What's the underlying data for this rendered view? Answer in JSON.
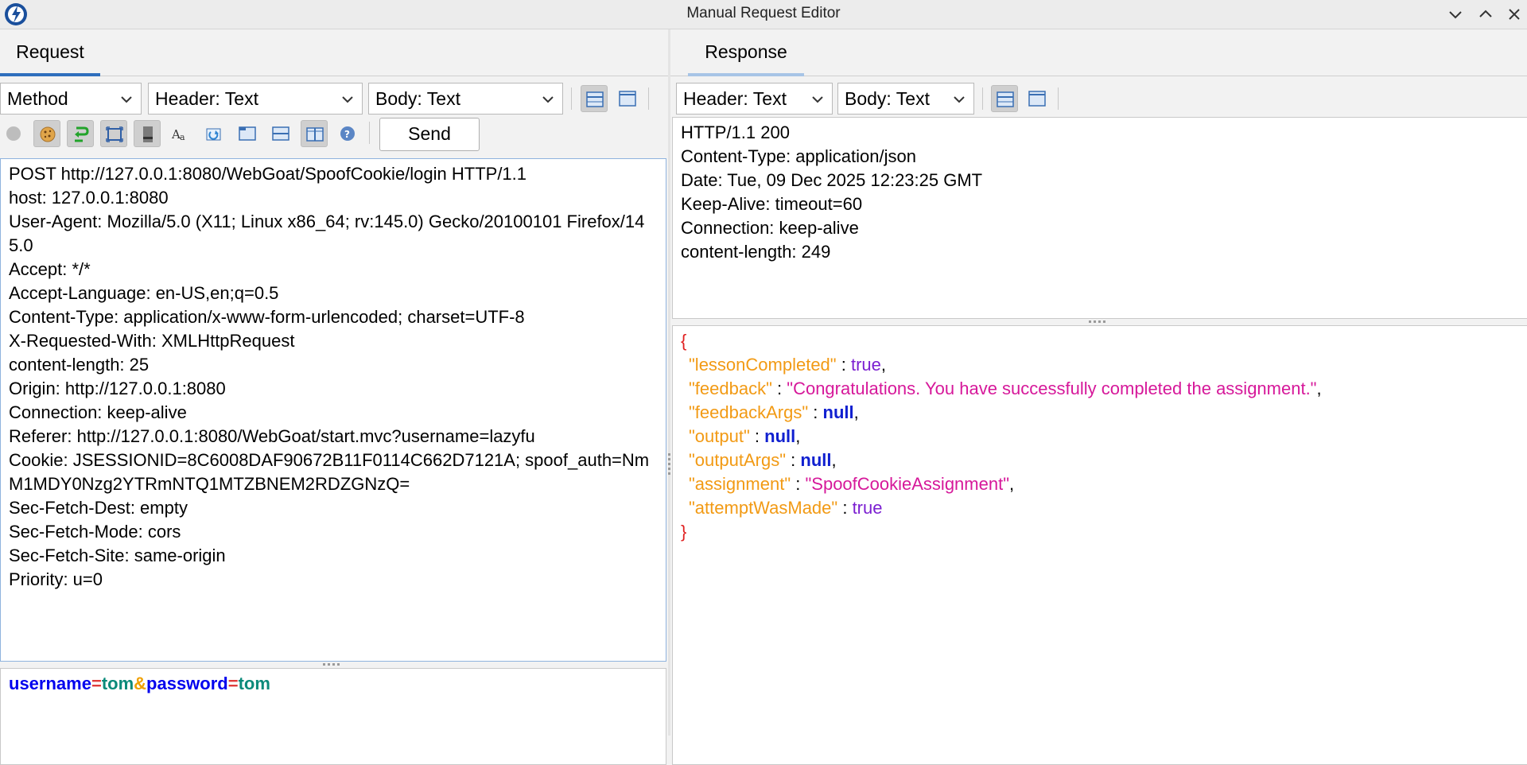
{
  "window": {
    "title": "Manual Request Editor"
  },
  "request": {
    "tab_label": "Request",
    "method_combo": "Method",
    "header_combo": "Header: Text",
    "body_combo": "Body: Text",
    "send_label": "Send",
    "header_lines": [
      "POST http://127.0.0.1:8080/WebGoat/SpoofCookie/login HTTP/1.1",
      "host: 127.0.0.1:8080",
      "User-Agent: Mozilla/5.0 (X11; Linux x86_64; rv:145.0) Gecko/20100101 Firefox/145.0",
      "Accept: */*",
      "Accept-Language: en-US,en;q=0.5",
      "Content-Type: application/x-www-form-urlencoded; charset=UTF-8",
      "X-Requested-With: XMLHttpRequest",
      "content-length: 25",
      "Origin: http://127.0.0.1:8080",
      "Connection: keep-alive",
      "Referer: http://127.0.0.1:8080/WebGoat/start.mvc?username=lazyfu",
      "Cookie: JSESSIONID=8C6008DAF90672B11F0114C662D7121A; spoof_auth=NmM1MDY0Nzg2YTRmNTQ1MTZBNEM2RDZGNzQ=",
      "Sec-Fetch-Dest: empty",
      "Sec-Fetch-Mode: cors",
      "Sec-Fetch-Site: same-origin",
      "Priority: u=0"
    ],
    "body": {
      "k1": "username",
      "eq1": "=",
      "v1": "tom",
      "amp": "&",
      "k2": "password",
      "eq2": "=",
      "v2": "tom"
    }
  },
  "response": {
    "tab_label": "Response",
    "header_combo": "Header: Text",
    "body_combo": "Body: Text",
    "header_lines": [
      "HTTP/1.1 200",
      "Content-Type: application/json",
      "Date: Tue, 09 Dec 2025 12:23:25 GMT",
      "Keep-Alive: timeout=60",
      "Connection: keep-alive",
      "content-length: 249"
    ],
    "json": {
      "open": "{",
      "close": "}",
      "entries": [
        {
          "key": "\"lessonCompleted\"",
          "value": "true",
          "type": "bool"
        },
        {
          "key": "\"feedback\"",
          "value": "\"Congratulations. You have successfully completed the assignment.\"",
          "type": "str"
        },
        {
          "key": "\"feedbackArgs\"",
          "value": "null",
          "type": "null"
        },
        {
          "key": "\"output\"",
          "value": "null",
          "type": "null"
        },
        {
          "key": "\"outputArgs\"",
          "value": "null",
          "type": "null"
        },
        {
          "key": "\"assignment\"",
          "value": "\"SpoofCookieAssignment\"",
          "type": "str"
        },
        {
          "key": "\"attemptWasMade\"",
          "value": "true",
          "type": "bool"
        }
      ]
    }
  },
  "icons": {
    "colors": {
      "accent": "#2f6fbd",
      "tab_inactive_underline": "#a7c4e6"
    }
  }
}
